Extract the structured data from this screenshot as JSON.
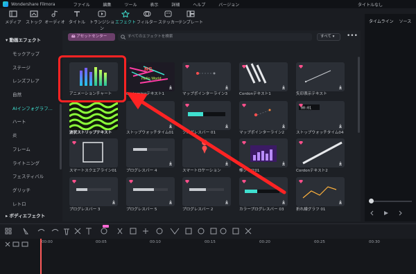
{
  "titlebar": {
    "app_name": "Wondershare Filmora",
    "menu": [
      "ファイル",
      "編集",
      "ツール",
      "表示",
      "詳細",
      "ヘルプ",
      "バージョン"
    ],
    "document": "タイトルなし"
  },
  "toolbar": {
    "items": [
      {
        "label": "メディア",
        "icon": "media-icon"
      },
      {
        "label": "ストック",
        "icon": "stock-icon"
      },
      {
        "label": "オーディオ",
        "icon": "audio-icon"
      },
      {
        "label": "タイトル",
        "icon": "title-icon"
      },
      {
        "label": "トランジション",
        "icon": "transition-icon"
      },
      {
        "label": "エフェクト",
        "icon": "effects-icon"
      },
      {
        "label": "フィルター",
        "icon": "filter-icon"
      },
      {
        "label": "ステッカー",
        "icon": "sticker-icon"
      },
      {
        "label": "テンプレート",
        "icon": "template-icon"
      }
    ],
    "active": "エフェクト"
  },
  "sidebar": {
    "section1": "動画エフェクト",
    "items": [
      "モックアップ",
      "ステージ",
      "レンズフレア",
      "自然",
      "AIインフォグラフ...",
      "ハート",
      "炎",
      "フレーム",
      "ライトニング",
      "フェスティバル",
      "グリッチ",
      "レトロ"
    ],
    "active_item": "AIインフォグラフ...",
    "section2": "ボディエフェクト"
  },
  "content": {
    "asset_center": "アセットセンター",
    "search_placeholder": "すべてのエフェクトを検索",
    "filter_label": "すべて",
    "more": "•••",
    "cards": [
      {
        "label": "アニメーションチャート"
      },
      {
        "label": "customingテキスト1"
      },
      {
        "label": "マップポインターライン3"
      },
      {
        "label": "Cordonテキスト1"
      },
      {
        "label": "矢印表示テキスト"
      },
      {
        "label": "波状ストリップテキスト"
      },
      {
        "label": "ストップウォッチタイム01"
      },
      {
        "label": "プログレスバー 01"
      },
      {
        "label": "マップポインターライン2"
      },
      {
        "label": "ストップウォッチタイム04"
      },
      {
        "label": "スマートスクエアライン01"
      },
      {
        "label": "プログレスバー 4"
      },
      {
        "label": "スマートロケーション"
      },
      {
        "label": "棒グラフ01"
      },
      {
        "label": "Cordonテキスト2"
      },
      {
        "label": "プログレスバー 3"
      },
      {
        "label": "プログレスバー 5"
      },
      {
        "label": "プログレスバー 2"
      },
      {
        "label": "カラープログレスバー 03"
      },
      {
        "label": "折れ線グラフ 01"
      }
    ],
    "card_texts": {
      "stopwatch": "00:01",
      "glitch": "Hello World"
    }
  },
  "rightpanel": {
    "tabs": [
      "タイムライン",
      "ソース"
    ]
  },
  "timeline": {
    "ticks": [
      "00:00",
      "00:05",
      "00:10",
      "00:15",
      "00:20",
      "00:25",
      "00:30"
    ]
  },
  "colors": {
    "accent": "#3fe0d0",
    "highlight": "#ff2323",
    "premium": "#ff4f8b"
  }
}
